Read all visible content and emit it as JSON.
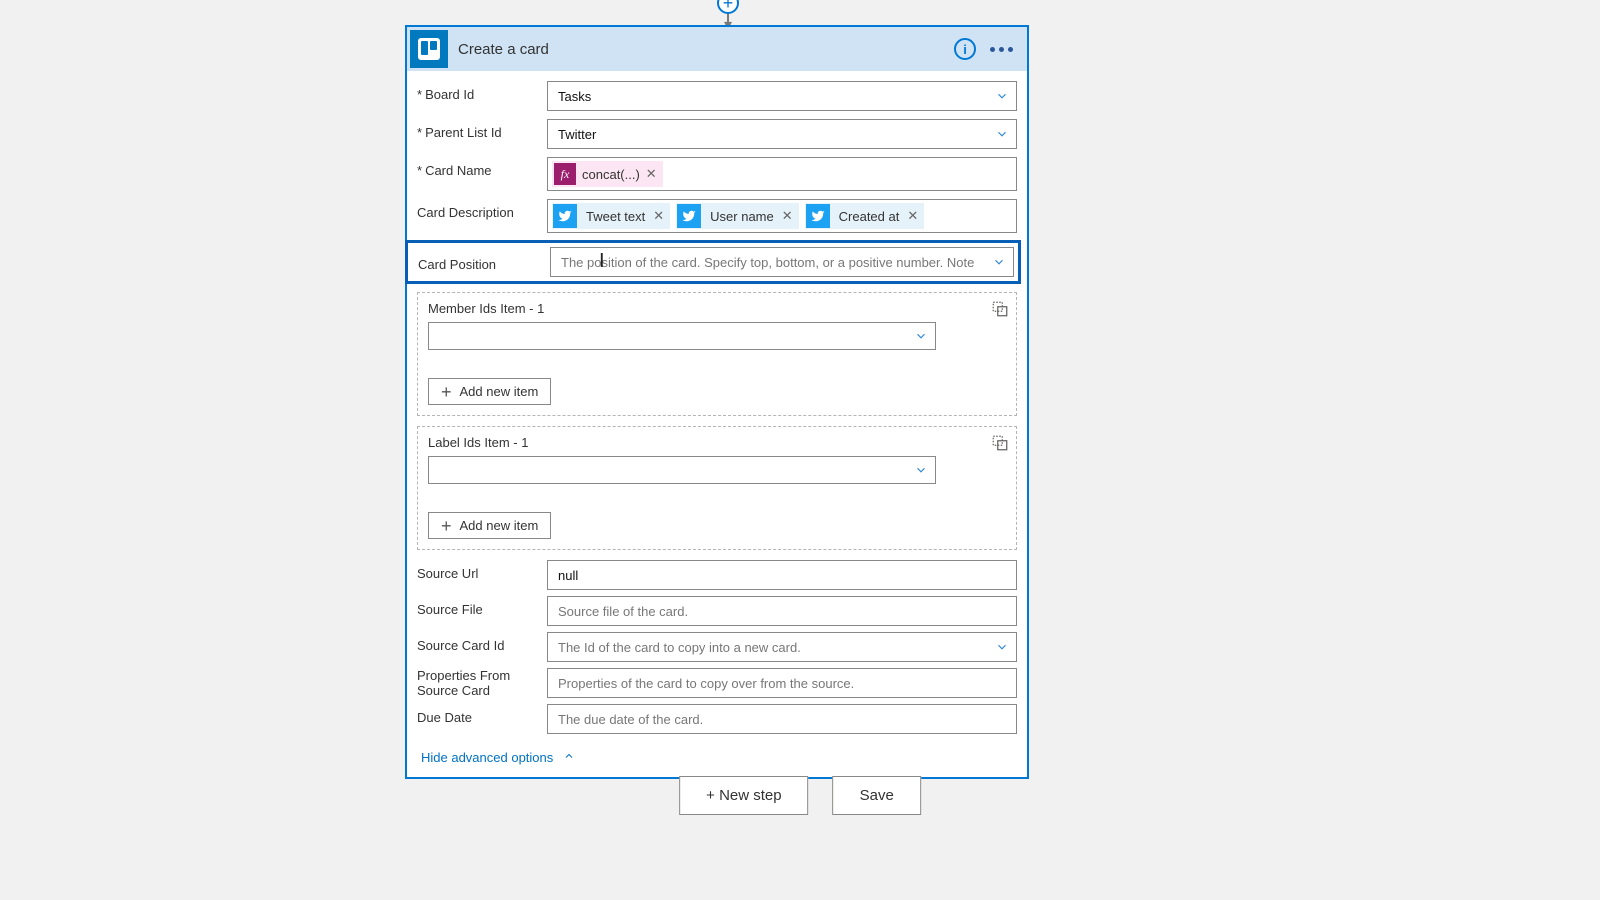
{
  "header": {
    "title": "Create a card"
  },
  "fields": {
    "board_id": {
      "label": "Board Id",
      "required": true,
      "value": "Tasks"
    },
    "parent_list_id": {
      "label": "Parent List Id",
      "required": true,
      "value": "Twitter"
    },
    "card_name": {
      "label": "Card Name",
      "required": true,
      "fx_label": "concat(...)"
    },
    "card_description": {
      "label": "Card Description",
      "tokens": [
        "Tweet text",
        "User name",
        "Created at"
      ]
    },
    "card_position": {
      "label": "Card Position",
      "placeholder": "The position of the card. Specify top, bottom, or a positive number. Note"
    },
    "member_ids": {
      "label": "Member Ids Item - 1",
      "add_label": "Add new item"
    },
    "label_ids": {
      "label": "Label Ids Item - 1",
      "add_label": "Add new item"
    },
    "source_url": {
      "label": "Source Url",
      "value": "null"
    },
    "source_file": {
      "label": "Source File",
      "placeholder": "Source file of the card."
    },
    "source_card_id": {
      "label": "Source Card Id",
      "placeholder": "The Id of the card to copy into a new card."
    },
    "properties_from_source": {
      "label": "Properties From Source Card",
      "placeholder": "Properties of the card to copy over from the source."
    },
    "due_date": {
      "label": "Due Date",
      "placeholder": "The due date of the card."
    }
  },
  "advanced_toggle": "Hide advanced options",
  "footer": {
    "new_step": "+ New step",
    "save": "Save"
  }
}
